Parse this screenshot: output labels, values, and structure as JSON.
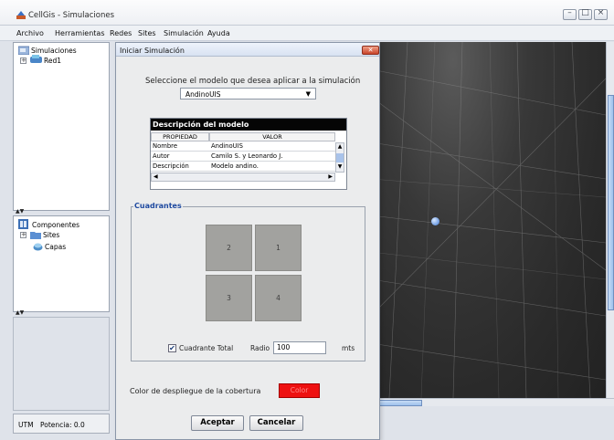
{
  "window": {
    "title": "CellGis - Simulaciones",
    "minimize_icon": "minimize-icon",
    "maximize_icon": "maximize-icon",
    "close_icon": "close-icon"
  },
  "menu": [
    "Archivo",
    "Herramientas",
    "Redes",
    "Sites",
    "Simulación",
    "Ayuda"
  ],
  "tree_top": {
    "root": "Simulaciones",
    "child": "Red1"
  },
  "tree_bottom": {
    "root": "Componentes",
    "sites": "Sites",
    "capas": "Capas"
  },
  "status": {
    "system": "UTM",
    "potencia": "Potencia: 0.0"
  },
  "dialog": {
    "title": "Iniciar Simulación",
    "prompt": "Seleccione el modelo que desea aplicar a la simulación",
    "model": "AndinoUIS",
    "desc_title": "Descripción del modelo",
    "columns": [
      "PROPIEDAD",
      "VALOR"
    ],
    "rows": [
      [
        "Nombre",
        "AndinoUIS"
      ],
      [
        "Autor",
        "Camilo S. y Leonardo J."
      ],
      [
        "Descripción",
        "Modelo andino."
      ]
    ],
    "quad_title": "Cuadrantes",
    "quadrants": [
      "2",
      "1",
      "3",
      "4"
    ],
    "cuadrante_total": "Cuadrante Total",
    "cuadrante_total_checked": true,
    "radio_label": "Radio",
    "radio_value": "100",
    "radio_unit": "mts",
    "color_label": "Color de despliegue de la cobertura",
    "color_button": "Color",
    "color_value": "#ee1111",
    "accept": "Aceptar",
    "cancel": "Cancelar"
  }
}
